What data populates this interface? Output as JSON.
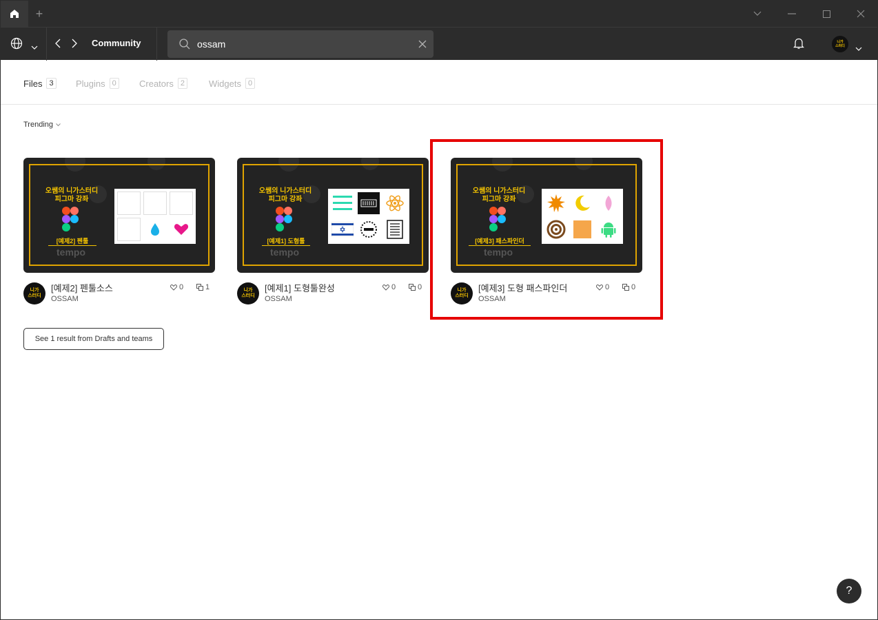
{
  "titlebar": {
    "home_icon": "home-icon",
    "new_tab_label": "+"
  },
  "nav": {
    "title": "Community"
  },
  "search": {
    "value": "ossam",
    "placeholder": ""
  },
  "tabs": [
    {
      "label": "Files",
      "count": "3"
    },
    {
      "label": "Plugins",
      "count": "0"
    },
    {
      "label": "Creators",
      "count": "2"
    },
    {
      "label": "Widgets",
      "count": "0"
    }
  ],
  "sort": {
    "label": "Trending"
  },
  "cards": [
    {
      "title": "[예제2] 펜툴소스",
      "author": "OSSAM",
      "likes": "0",
      "duplicates": "1",
      "thumb_text": "오쌤의 니가스터디\n피그마 강좌",
      "thumb_label": "[예제2] 펜툴",
      "tempo": "tempo"
    },
    {
      "title": "[예제1] 도형툴완성",
      "author": "OSSAM",
      "likes": "0",
      "duplicates": "0",
      "thumb_text": "오쌤의 니가스터디\n피그마 강좌",
      "thumb_label": "[예제1] 도형툴",
      "tempo": "tempo"
    },
    {
      "title": "[예제3] 도형 패스파인더",
      "author": "OSSAM",
      "likes": "0",
      "duplicates": "0",
      "thumb_text": "오쌤의 니가스터디\n피그마 강좌",
      "thumb_label": "[예제3] 패스파인더",
      "tempo": "tempo"
    }
  ],
  "avatar_text": {
    "line1": "니가",
    "line2": "스터디"
  },
  "drafts_button": {
    "label": "See 1 result from Drafts and teams"
  },
  "help": {
    "label": "?"
  },
  "colors": {
    "highlight": "#e60000",
    "dark": "#2c2c2c",
    "accent_yellow": "#f5c400"
  }
}
